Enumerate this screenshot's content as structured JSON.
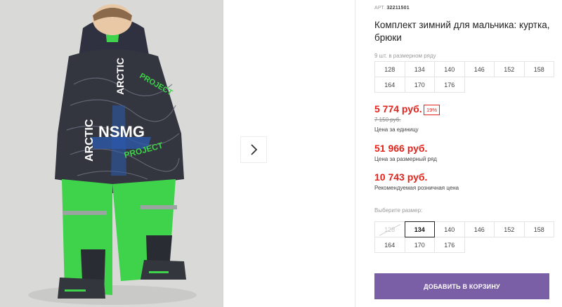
{
  "product": {
    "art_label": "АРТ.",
    "art_number": "32211501",
    "title": "Комплект зимний для мальчика: куртка, брюки"
  },
  "size_row": {
    "label": "9 шт. в размерном ряду",
    "sizes": [
      "128",
      "134",
      "140",
      "146",
      "152",
      "158",
      "164",
      "170",
      "176"
    ]
  },
  "prices": {
    "unit_price": "5 774 руб.",
    "discount_badge": "19%",
    "old_price": "7 150 руб.",
    "unit_caption": "Цена за единицу",
    "row_price": "51 966 руб.",
    "row_caption": "Цена за размерный ряд",
    "rrp_price": "10 743 руб.",
    "rrp_caption": "Рекомендуемая розничная цена"
  },
  "size_select": {
    "label": "Выберите размер:",
    "sizes": [
      "128",
      "134",
      "140",
      "146",
      "152",
      "158",
      "164",
      "170",
      "176"
    ],
    "selected": "134",
    "disabled": [
      "128"
    ]
  },
  "cart": {
    "button_label": "ДОБАВИТЬ В КОРЗИНУ"
  },
  "photo": {
    "jacket_text": [
      "ARCTIC",
      "ARCTIC",
      "PROJECT",
      "NSMG",
      "PROJECT"
    ]
  },
  "colors": {
    "accent": "#e2231a",
    "button": "#7b5fa6",
    "pants": "#3fd24b"
  },
  "icons": {
    "next": "chevron-right-icon"
  }
}
